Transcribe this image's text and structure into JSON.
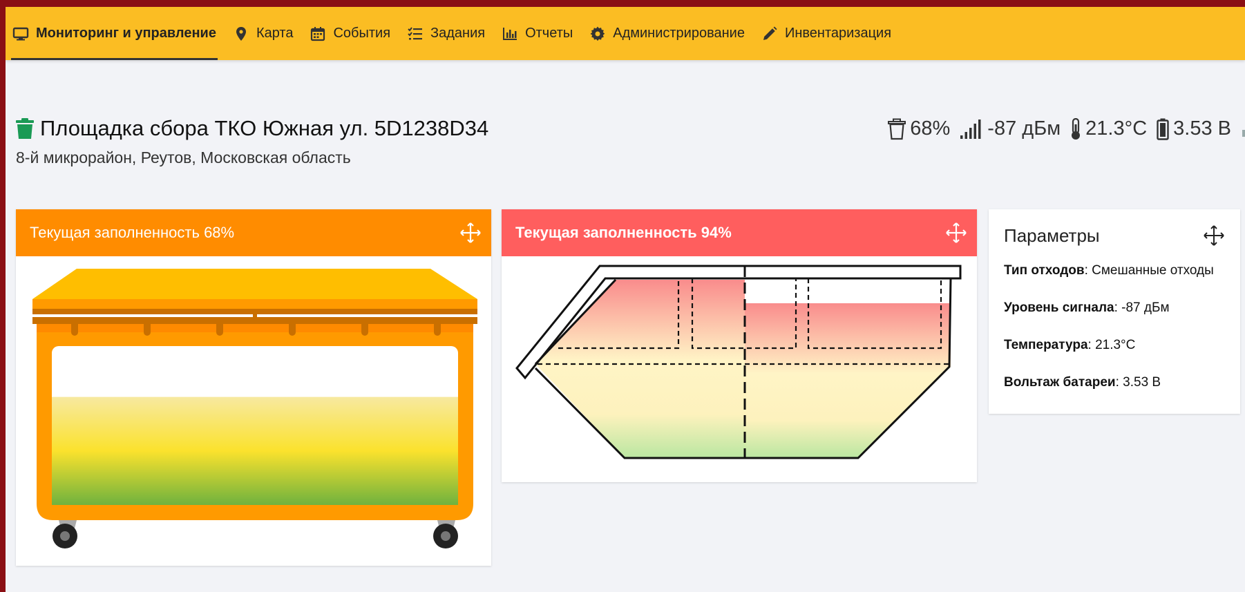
{
  "nav": {
    "items": [
      {
        "label": "Мониторинг и управление",
        "icon": "monitor-icon",
        "active": true
      },
      {
        "label": "Карта",
        "icon": "map-marker-icon",
        "active": false
      },
      {
        "label": "События",
        "icon": "calendar-icon",
        "active": false
      },
      {
        "label": "Задания",
        "icon": "tasks-list-icon",
        "active": false
      },
      {
        "label": "Отчеты",
        "icon": "bar-chart-icon",
        "active": false
      },
      {
        "label": "Администрирование",
        "icon": "gear-icon",
        "active": false
      },
      {
        "label": "Инвентаризация",
        "icon": "pencil-icon",
        "active": false
      }
    ]
  },
  "site": {
    "title": "Площадка сбора ТКО Южная ул. 5D1238D34",
    "address": "8-й микрорайон, Реутов, Московская область",
    "icon": "trash-icon",
    "icon_color": "#1a9a55"
  },
  "status": {
    "fill": "68%",
    "signal": "-87 дБм",
    "temperature": "21.3°C",
    "battery": "3.53 В"
  },
  "card1": {
    "title": "Текущая заполненность 68%",
    "fill_fraction": 0.68,
    "header_color": "#ff8c00"
  },
  "card2": {
    "title": "Текущая заполненность 94%",
    "fill_fraction": 0.94,
    "header_color": "#ff5e5e"
  },
  "params": {
    "title": "Параметры",
    "rows": [
      {
        "label": "Тип отходов",
        "value": ": Смешанные отходы"
      },
      {
        "label": "Уровень сигнала",
        "value": ": -87 дБм"
      },
      {
        "label": "Температура",
        "value": ": 21.3°C"
      },
      {
        "label": "Вольтаж батареи",
        "value": ": 3.53 В"
      }
    ]
  }
}
